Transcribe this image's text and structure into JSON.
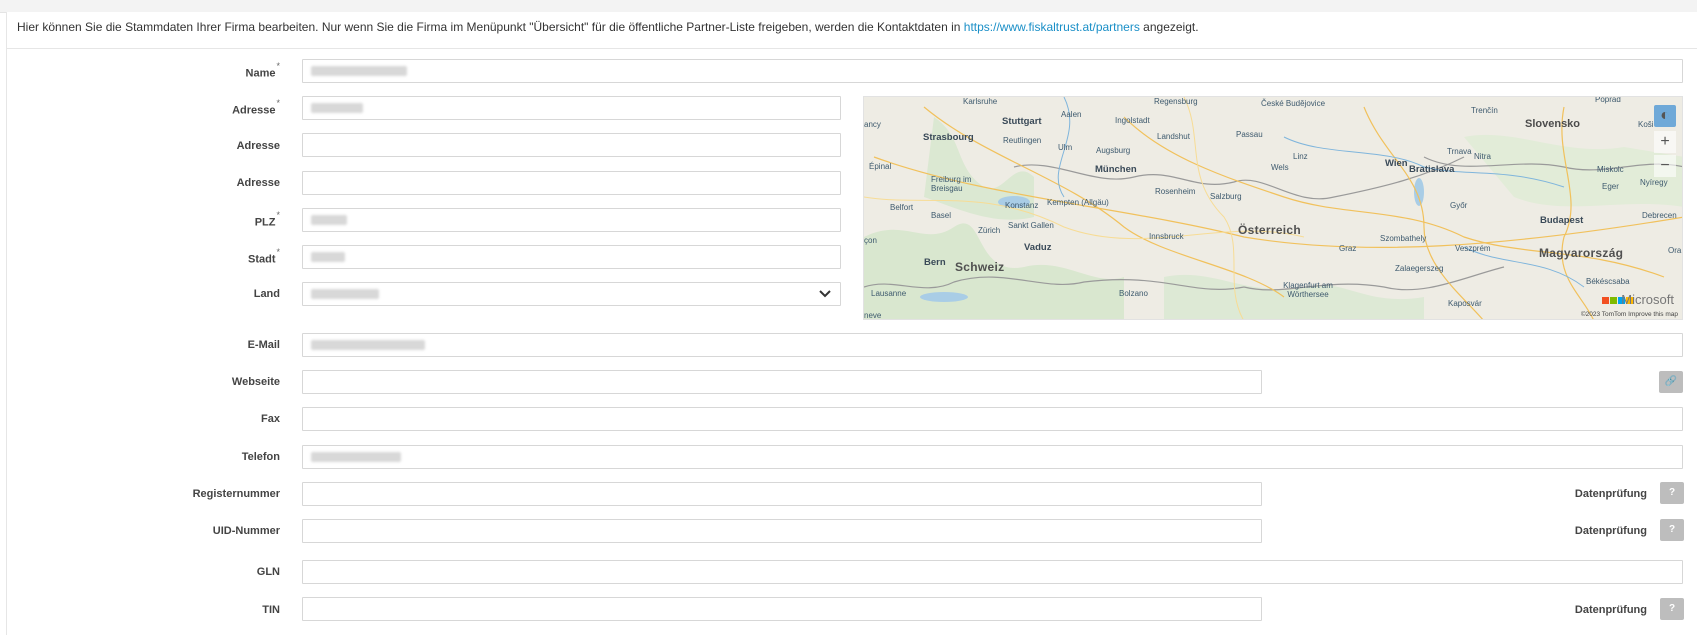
{
  "info": {
    "text_before": "Hier können Sie die Stammdaten Ihrer Firma bearbeiten. Nur wenn Sie die Firma im Menüpunkt \"Übersicht\" für die öffentliche Partner-Liste freigeben, werden die Kontaktdaten in ",
    "link": "https://www.fiskaltrust.at/partners",
    "text_after": " angezeigt."
  },
  "fields": {
    "name": {
      "label": "Name",
      "required": "*"
    },
    "adresse1": {
      "label": "Adresse",
      "required": "*"
    },
    "adresse2": {
      "label": "Adresse"
    },
    "adresse3": {
      "label": "Adresse"
    },
    "plz": {
      "label": "PLZ",
      "required": "*"
    },
    "stadt": {
      "label": "Stadt",
      "required": "*"
    },
    "land": {
      "label": "Land"
    },
    "email": {
      "label": "E-Mail"
    },
    "webseite": {
      "label": "Webseite"
    },
    "fax": {
      "label": "Fax"
    },
    "telefon": {
      "label": "Telefon"
    },
    "registernummer": {
      "label": "Registernummer"
    },
    "uid": {
      "label": "UID-Nummer"
    },
    "gln": {
      "label": "GLN"
    },
    "tin": {
      "label": "TIN"
    }
  },
  "buttons": {
    "check_label": "Datenprüfung",
    "help_glyph": "?",
    "link_glyph": "🔗"
  },
  "map": {
    "zoom_in": "+",
    "zoom_out": "−",
    "compass_glyph": "◐",
    "brand": "Microsoft",
    "copyright": "©2023 TomTom Improve this map",
    "brand_colors": [
      "#f25022",
      "#7fba00",
      "#00a4ef",
      "#ffb900"
    ],
    "labels": {
      "karlsruhe": "Karlsruhe",
      "regensburg": "Regensburg",
      "budejovice": "České Budějovice",
      "poprad": "Poprad",
      "stuttgart": "Stuttgart",
      "aalen": "Aalen",
      "ingolstadt": "Ingolstadt",
      "trencin": "Trenčín",
      "strasbourg": "Strasbourg",
      "reutlingen": "Reutlingen",
      "ulm": "Ulm",
      "landshut": "Landshut",
      "passau": "Passau",
      "slovensko": "Slovensko",
      "kosice": "Koši",
      "augsburg": "Augsburg",
      "linz": "Linz",
      "trnava": "Trnava",
      "nitra": "Nitra",
      "epinal": "Épinal",
      "munchen": "München",
      "wels": "Wels",
      "wien": "Wien",
      "bratislava": "Bratislava",
      "miskolc": "Miskolc",
      "freiburg": "Freiburg im Breisgau",
      "rosenheim": "Rosenheim",
      "eger": "Eger",
      "nyiregy": "Nyíregy",
      "konstanz": "Konstanz",
      "kempten": "Kempten (Allgäu)",
      "salzburg": "Salzburg",
      "gyor": "Győr",
      "belfort": "Belfort",
      "basel": "Basel",
      "budapest": "Budapest",
      "debrecen": "Debrecen",
      "zurich": "Zürich",
      "sanktgallen": "Sankt Gallen",
      "osterreich": "Österreich",
      "innsbruck": "Innsbruck",
      "szombathely": "Szombathely",
      "vaduz": "Vaduz",
      "graz": "Graz",
      "veszprem": "Veszprém",
      "magyarorszag": "Magyarország",
      "ora": "Ora",
      "bern": "Bern",
      "schweiz": "Schweiz",
      "zalaegerszeg": "Zalaegerszeg",
      "bekescsaba": "Békéscsaba",
      "lausanne": "Lausanne",
      "bolzano": "Bolzano",
      "klagenfurt": "Klagenfurt am Wörthersee",
      "kaposvar": "Kaposvár",
      "besancon": "çon",
      "neve": "neve",
      "ancy": "ancy"
    }
  }
}
